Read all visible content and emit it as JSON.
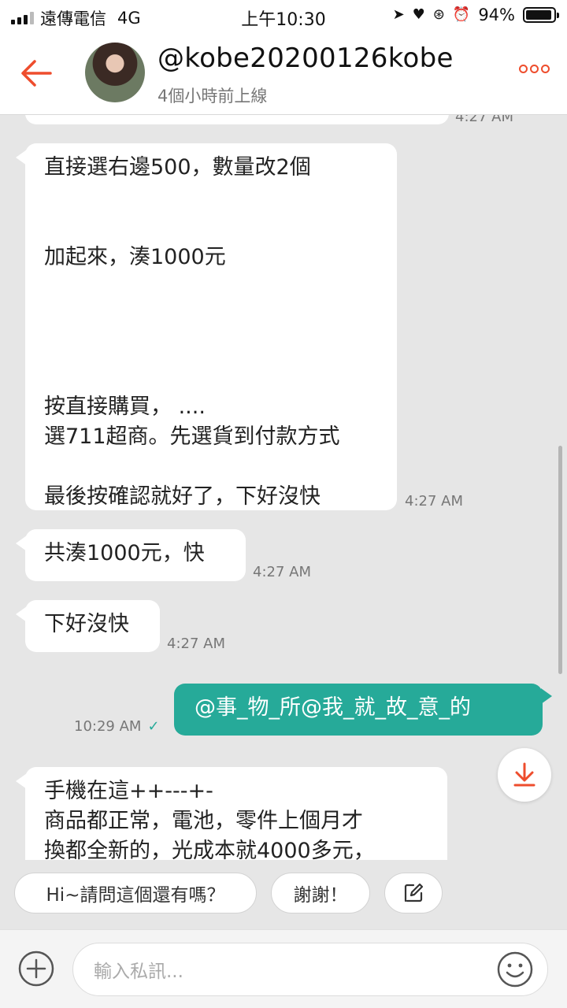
{
  "status_bar": {
    "carrier": "遠傳電信",
    "network": "4G",
    "time": "上午10:30",
    "battery_percent": "94%",
    "battery_level": 0.94
  },
  "header": {
    "back_icon": "arrow-left-icon",
    "username": "@kobe20200126kobe",
    "last_seen": "4個小時前上線",
    "more_icon": "more-dots-icon",
    "accent_color": "#ee4d2d"
  },
  "messages": [
    {
      "direction": "in",
      "text": "直接選右邊500，數量改2個\n\n\n加起來，湊1000元\n\n\n\n\n按直接購買，   ....\n選711超商。先選貨到付款方式\n\n最後按確認就好了，下好沒快",
      "time": "4:27 AM"
    },
    {
      "direction": "in",
      "text": "共湊1000元，快",
      "time": "4:27 AM"
    },
    {
      "direction": "in",
      "text": "下好沒快",
      "time": "4:27 AM"
    },
    {
      "direction": "out",
      "text": "@事_物_所@我_就_故_意_的",
      "time": "10:29 AM",
      "read": "✓"
    },
    {
      "direction": "in",
      "text": "手機在這++---+-\n商品都正常，電池，零件上個月才\n換都全新的，光成本就4000多元，",
      "time": ""
    }
  ],
  "partial_top_time": "4:27 AM",
  "quick_replies": [
    "Hi~請問這個還有嗎？",
    "謝謝！"
  ],
  "edit_icon": "edit-icon",
  "input": {
    "placeholder": "輸入私訊...",
    "plus_icon": "plus-circle-icon",
    "emoji_icon": "smiley-icon"
  },
  "colors": {
    "outgoing_bubble": "#26aa99",
    "brand": "#ee4d2d"
  }
}
